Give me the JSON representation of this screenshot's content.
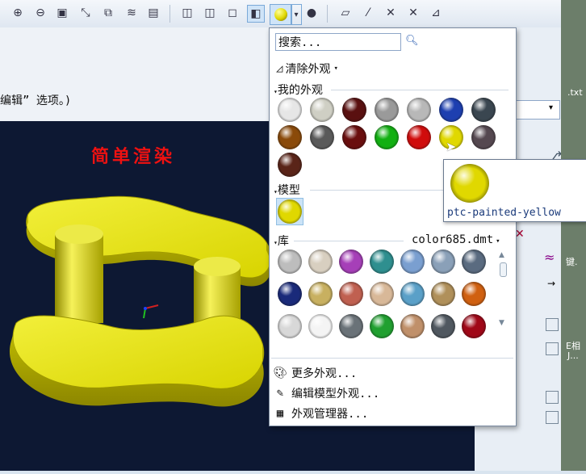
{
  "message": {
    "text": "编辑” 选项。)"
  },
  "viewport": {
    "title": "简单渲染"
  },
  "toolbar": {
    "icons": [
      "zoom-in-icon",
      "zoom-out-icon",
      "refit-icon",
      "reorient-icon",
      "view-manager-icon",
      "layers-icon",
      "saved-views-icon",
      "shading-icon",
      "hidden-line-icon",
      "no-hidden-icon",
      "wireframe-icon",
      "appearance-icon",
      "dropdown-arrow-icon",
      "scene-icon",
      "datum-plane-icon",
      "datum-axis-icon",
      "datum-point-icon",
      "csys-icon",
      "annotation-icon"
    ]
  },
  "appearance_menu": {
    "search_placeholder": "搜索...",
    "clear_label": "清除外观",
    "my_appearances_label": "我的外观",
    "model_label": "模型",
    "library_label": "库",
    "library_file": "color685.dmt",
    "more_label": "更多外观...",
    "edit_model_label": "编辑模型外观...",
    "manager_label": "外观管理器...",
    "my_swatches": [
      {
        "name": "white",
        "color": "#e6e6e6"
      },
      {
        "name": "light-gray",
        "color": "#cfcfc4"
      },
      {
        "name": "dark-red-brown",
        "color": "#5a1010"
      },
      {
        "name": "gray-split",
        "color": "#9a9a9a"
      },
      {
        "name": "silver",
        "color": "#b8b8b8"
      },
      {
        "name": "blue",
        "color": "#1d3fb0"
      },
      {
        "name": "dark-slate",
        "color": "#3a4650"
      },
      {
        "name": "bronze",
        "color": "#8a4a0a"
      },
      {
        "name": "dark-gray",
        "color": "#5a5a5a"
      },
      {
        "name": "dark-red",
        "color": "#6a0e0e"
      },
      {
        "name": "green",
        "color": "#12b012"
      },
      {
        "name": "red",
        "color": "#d00c0c"
      },
      {
        "name": "yellow",
        "color": "#e0d800"
      },
      {
        "name": "granite",
        "color": "#554850"
      },
      {
        "name": "rust",
        "color": "#5a2418"
      }
    ],
    "model_swatch": {
      "name": "ptc-painted-yellow",
      "color": "#e0d800"
    },
    "library_swatches": [
      {
        "color": "#bdbdbd"
      },
      {
        "color": "#d8cfc0"
      },
      {
        "color": "#a63fb8"
      },
      {
        "color": "#2e8f8f"
      },
      {
        "color": "#7a9fd0"
      },
      {
        "color": "#8aa0b8"
      },
      {
        "color": "#5a6b80"
      },
      {
        "color": "#1a2a7a"
      },
      {
        "color": "#c8b060"
      },
      {
        "color": "#c06050"
      },
      {
        "color": "#d8b898"
      },
      {
        "color": "#5aa0c8"
      },
      {
        "color": "#b0905a"
      },
      {
        "color": "#d06010"
      },
      {
        "color": "#d8d8d8"
      },
      {
        "color": "#f4f4f4"
      },
      {
        "color": "#6a7278"
      },
      {
        "color": "#20a030"
      },
      {
        "color": "#c0906a"
      },
      {
        "color": "#505860"
      },
      {
        "color": "#a00818"
      }
    ]
  },
  "tooltip": {
    "label": "ptc-painted-yellow",
    "color": "#e0d800"
  },
  "right_panel": {
    "txt_label": ".txt",
    "jian_label": "键.",
    "xiang_label": "E相",
    "j_label": "J..."
  }
}
